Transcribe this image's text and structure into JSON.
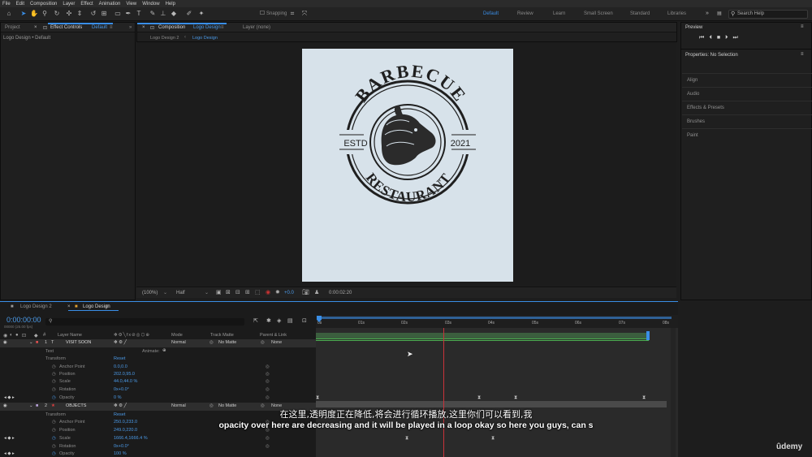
{
  "menu": [
    "File",
    "Edit",
    "Composition",
    "Layer",
    "Effect",
    "Animation",
    "View",
    "Window",
    "Help"
  ],
  "toolbar": {
    "snapping_label": "Snapping",
    "workspaces": [
      "Default",
      "Review",
      "Learn",
      "Small Screen",
      "Standard",
      "Libraries"
    ],
    "active_workspace": "Default",
    "search_placeholder": "Search Help"
  },
  "left_panel": {
    "tab_project": "Project",
    "tab_effect_controls": "Effect Controls",
    "effect_controls_target": "Default",
    "subtitle": "Logo Design • Default"
  },
  "comp_panel": {
    "tab_composition": "Composition",
    "composition_name": "Logo Design",
    "tab_layer": "Layer (none)",
    "breadcrumb": [
      "Logo Design 2",
      "Logo Design"
    ],
    "zoom": "(100%)",
    "resolution": "Half",
    "exposure": "+0.0",
    "timecode": "0:00:02:20"
  },
  "logo": {
    "top_text": "BARBECUE",
    "left_text": "ESTD",
    "right_text": "2021",
    "bottom_text": "RESTAURANT"
  },
  "right_panel": {
    "preview_title": "Preview",
    "properties_title": "Properties: No Selection",
    "sections": [
      "Align",
      "Audio",
      "Effects & Presets",
      "Brushes",
      "Paint"
    ]
  },
  "timeline": {
    "tabs": [
      "Logo Design 2",
      "Logo Design"
    ],
    "current_time": "0:00:00:00",
    "fps_info": "00000 (25.00 fps)",
    "col_headers": {
      "layer_name": "Layer Name",
      "mode": "Mode",
      "track_matte": "Track Matte",
      "parent": "Parent & Link"
    },
    "ruler": [
      "0s",
      "01s",
      "02s",
      "03s",
      "04s",
      "05s",
      "06s",
      "07s",
      "08s"
    ],
    "layers": [
      {
        "num": "1",
        "name": "VISIT SOON",
        "mode": "Normal",
        "matte": "No Matte",
        "parent": "None"
      },
      {
        "num": "2",
        "name": "OBJECTS",
        "mode": "Normal",
        "matte": "No Matte",
        "parent": "None"
      }
    ],
    "text_label": "Text",
    "animate_label": "Animate:",
    "transform_label": "Transform",
    "reset_label": "Reset",
    "props1": [
      {
        "name": "Anchor Point",
        "value": "0.0,0.0"
      },
      {
        "name": "Position",
        "value": "202.0,95.0"
      },
      {
        "name": "Scale",
        "value": "44.0,44.0 %"
      },
      {
        "name": "Rotation",
        "value": "0x+0.0°"
      },
      {
        "name": "Opacity",
        "value": "0 %"
      }
    ],
    "props2": [
      {
        "name": "Anchor Point",
        "value": "250.0,233.0"
      },
      {
        "name": "Position",
        "value": "249.0,220.0"
      },
      {
        "name": "Scale",
        "value": "1666.4,1666.4 %"
      },
      {
        "name": "Rotation",
        "value": "0x+0.0°"
      },
      {
        "name": "Opacity",
        "value": "100 %"
      }
    ]
  },
  "subtitles": {
    "cn": "在这里,透明度正在降低,将会进行循环播放,这里你们可以看到,我",
    "en": "opacity over here are decreasing and it will be played in a loop okay so here you guys, can s"
  },
  "watermark": "ûdemy",
  "colors": {
    "accent": "#3a8ee6",
    "artboard": "#d7e2ea",
    "playhead": "#c8323a",
    "logo_ink": "#1f1f1f"
  }
}
